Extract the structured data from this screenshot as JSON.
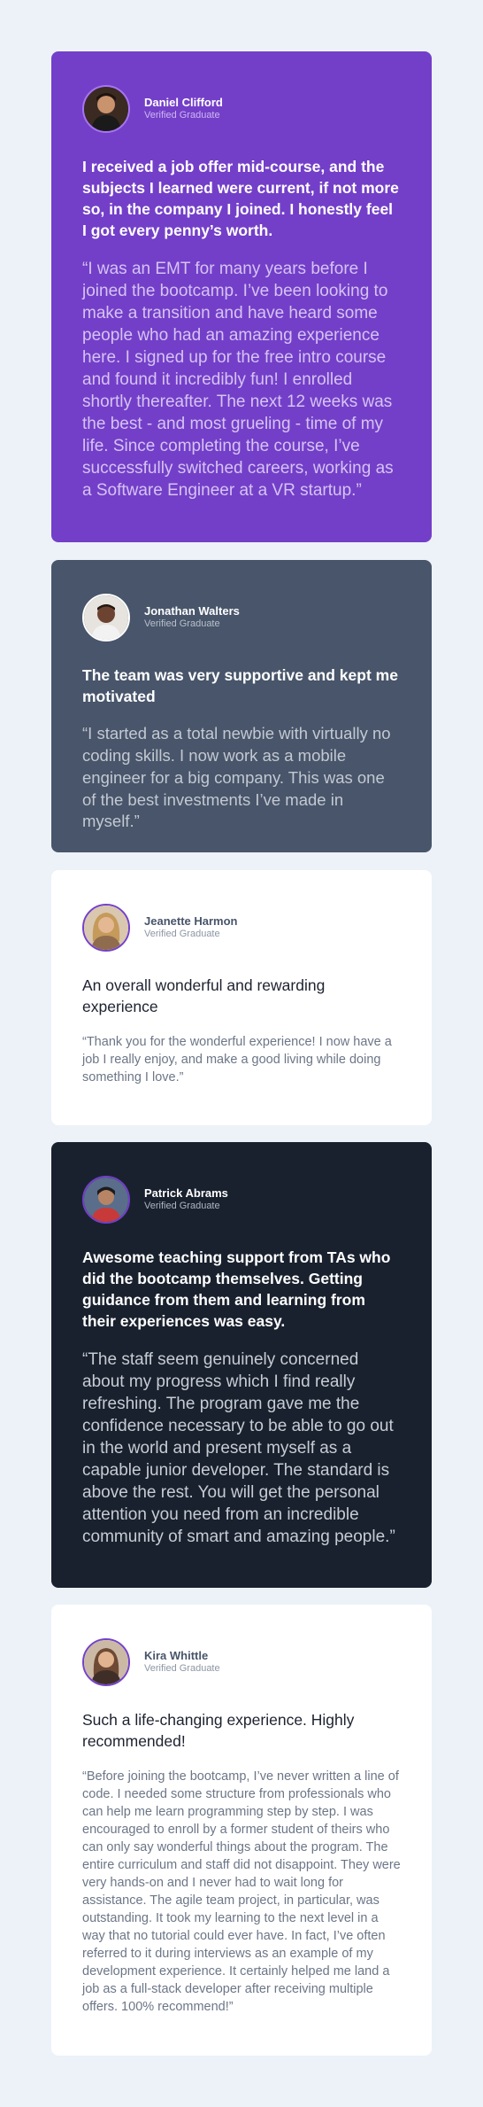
{
  "testimonials": [
    {
      "name": "Daniel Clifford",
      "status": "Verified Graduate",
      "headline": "I received a job offer mid-course, and the subjects I learned were current, if not more so, in the company I joined. I honestly feel I got every penny’s worth.",
      "quote": "“I was an EMT for many years before I joined the bootcamp. I’ve been looking to make a transition and have heard some people who had an amazing experience here. I signed up for the free intro course and found it incredibly fun! I enrolled shortly thereafter. The next 12 weeks was the best - and most grueling - time of my life. Since completing the course, I’ve successfully switched careers, working as a Software Engineer at a VR startup.”",
      "avatar_icon": "person-avatar-icon",
      "card_color": "#733fc8"
    },
    {
      "name": "Jonathan Walters",
      "status": "Verified Graduate",
      "headline": "The team was very supportive and kept me motivated",
      "quote": "“I started as a total newbie with virtually no coding skills. I now work as a mobile engineer for a big company. This was one of the best investments I’ve made in myself.”",
      "avatar_icon": "person-avatar-icon",
      "card_color": "#48556a"
    },
    {
      "name": "Jeanette Harmon",
      "status": "Verified Graduate",
      "headline": "An overall wonderful and rewarding experience",
      "quote": "“Thank you for the wonderful experience! I now have a job I really enjoy, and make a good living while doing something I love.”",
      "avatar_icon": "person-avatar-icon",
      "card_color": "#ffffff"
    },
    {
      "name": "Patrick Abrams",
      "status": "Verified Graduate",
      "headline": "Awesome teaching support from TAs who did the bootcamp themselves. Getting guidance from them and learning from their experiences was easy.",
      "quote": "“The staff seem genuinely concerned about my progress which I find really refreshing. The program gave me the confidence necessary to be able to go out in the world and present myself as a capable junior developer. The standard is above the rest. You will get the personal attention you need from an incredible community of smart and amazing people.”",
      "avatar_icon": "person-avatar-icon",
      "card_color": "#19212e"
    },
    {
      "name": "Kira Whittle",
      "status": "Verified Graduate",
      "headline": "Such a life-changing experience. Highly recommended!",
      "quote": "“Before joining the bootcamp, I’ve never written a line of code. I needed some structure from professionals who can help me learn programming step by step. I was encouraged to enroll by a former student of theirs who can only say wonderful things about the program. The entire curriculum and staff did not disappoint. They were very hands-on and I never had to wait long for assistance. The agile team project, in particular, was outstanding. It took my learning to the next level in a way that no tutorial could ever have. In fact, I’ve often referred to it during interviews as an example of my development experience. It certainly helped me land a job as a full-stack developer after receiving multiple offers. 100% recommend!”",
      "avatar_icon": "person-avatar-icon",
      "card_color": "#ffffff"
    }
  ],
  "colors": {
    "background": "#ecf2f8",
    "accent_purple": "#733fc8",
    "slate": "#48556a",
    "dark": "#19212e"
  }
}
